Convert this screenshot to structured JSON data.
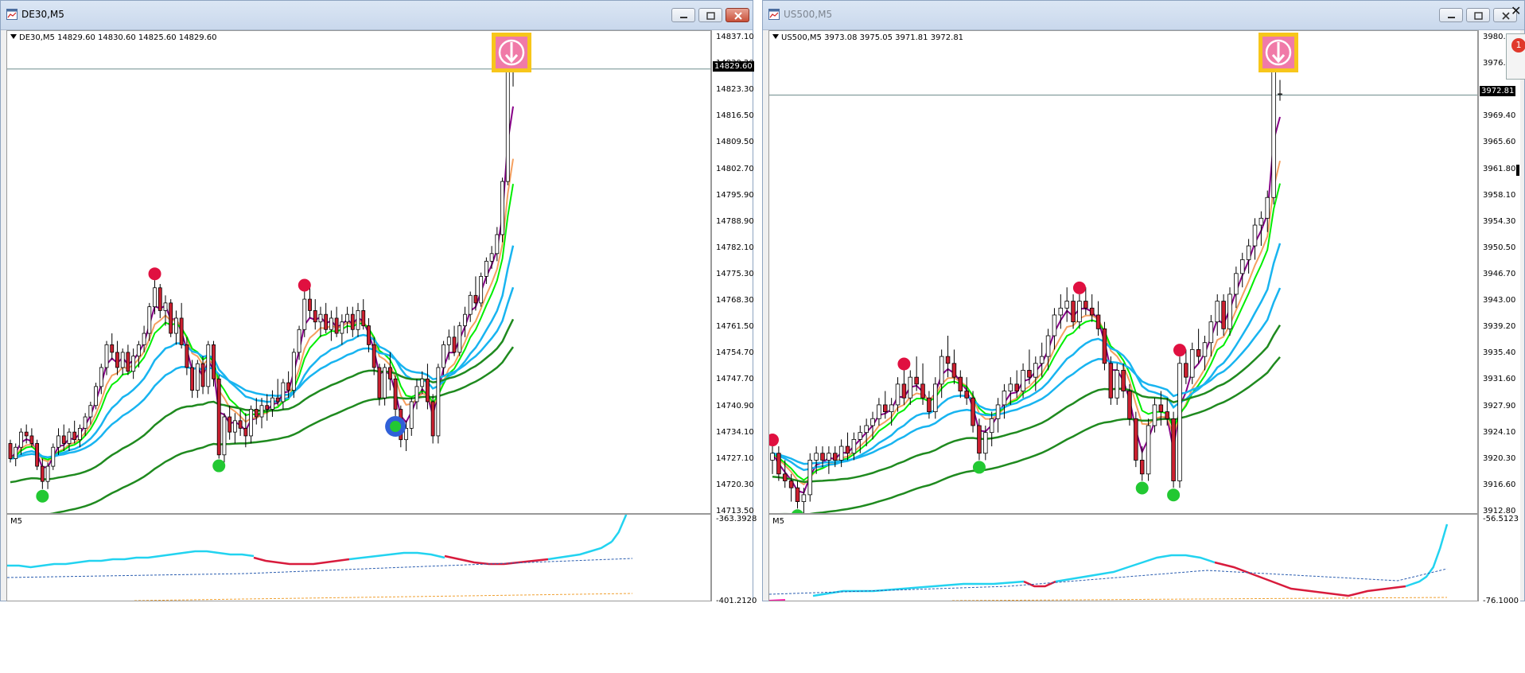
{
  "windows": [
    {
      "id": "de30",
      "title": "DE30,M5",
      "ohlc_label": "DE30,M5  14829.60 14830.60 14825.60 14829.60",
      "indicator_label": "M5",
      "price_ticks": [
        "14837.10",
        "14830.20",
        "14823.30",
        "14816.50",
        "14809.50",
        "14802.70",
        "14795.90",
        "14788.90",
        "14782.10",
        "14775.30",
        "14768.30",
        "14761.50",
        "14754.70",
        "14747.70",
        "14740.90",
        "14734.10",
        "14727.10",
        "14720.30",
        "14713.50"
      ],
      "current_price": "14829.60",
      "indicator_value": "-363.3928",
      "indicator_low_value": "-401.2120",
      "price_range": [
        14713.5,
        14837.1
      ],
      "candles": [
        [
          14731,
          14732,
          14726,
          14727
        ],
        [
          14727,
          14731,
          14725,
          14730
        ],
        [
          14730,
          14735,
          14728,
          14734
        ],
        [
          14734,
          14736,
          14731,
          14733
        ],
        [
          14733,
          14735,
          14730,
          14731
        ],
        [
          14731,
          14732,
          14724,
          14725
        ],
        [
          14725,
          14727,
          14719,
          14721
        ],
        [
          14721,
          14726,
          14719,
          14725
        ],
        [
          14725,
          14731,
          14724,
          14730
        ],
        [
          14730,
          14735,
          14728,
          14733
        ],
        [
          14733,
          14736,
          14729,
          14731
        ],
        [
          14731,
          14735,
          14729,
          14734
        ],
        [
          14734,
          14737,
          14731,
          14732
        ],
        [
          14732,
          14736,
          14730,
          14735
        ],
        [
          14735,
          14739,
          14733,
          14738
        ],
        [
          14738,
          14742,
          14736,
          14741
        ],
        [
          14741,
          14747,
          14740,
          14746
        ],
        [
          14746,
          14752,
          14744,
          14751
        ],
        [
          14751,
          14758,
          14749,
          14757
        ],
        [
          14757,
          14760,
          14753,
          14755
        ],
        [
          14755,
          14758,
          14749,
          14751
        ],
        [
          14751,
          14756,
          14749,
          14755
        ],
        [
          14755,
          14757,
          14749,
          14750
        ],
        [
          14750,
          14756,
          14748,
          14754
        ],
        [
          14754,
          14758,
          14751,
          14757
        ],
        [
          14757,
          14762,
          14755,
          14760
        ],
        [
          14760,
          14768,
          14758,
          14767
        ],
        [
          14767,
          14774,
          14765,
          14772
        ],
        [
          14772,
          14773,
          14764,
          14766
        ],
        [
          14766,
          14770,
          14762,
          14768
        ],
        [
          14768,
          14769,
          14759,
          14760
        ],
        [
          14760,
          14766,
          14757,
          14764
        ],
        [
          14764,
          14768,
          14756,
          14757
        ],
        [
          14757,
          14759,
          14749,
          14751
        ],
        [
          14751,
          14753,
          14743,
          14745
        ],
        [
          14745,
          14753,
          14743,
          14752
        ],
        [
          14752,
          14754,
          14744,
          14746
        ],
        [
          14746,
          14758,
          14744,
          14757
        ],
        [
          14757,
          14758,
          14746,
          14748
        ],
        [
          14748,
          14749,
          14727,
          14728
        ],
        [
          14728,
          14739,
          14726,
          14738
        ],
        [
          14738,
          14741,
          14732,
          14734
        ],
        [
          14734,
          14739,
          14731,
          14737
        ],
        [
          14737,
          14740,
          14733,
          14735
        ],
        [
          14735,
          14739,
          14730,
          14733
        ],
        [
          14733,
          14741,
          14731,
          14740
        ],
        [
          14740,
          14743,
          14736,
          14738
        ],
        [
          14738,
          14743,
          14735,
          14741
        ],
        [
          14741,
          14744,
          14737,
          14740
        ],
        [
          14740,
          14745,
          14738,
          14743
        ],
        [
          14743,
          14748,
          14741,
          14742
        ],
        [
          14742,
          14748,
          14740,
          14747
        ],
        [
          14747,
          14750,
          14743,
          14745
        ],
        [
          14745,
          14756,
          14743,
          14755
        ],
        [
          14755,
          14762,
          14753,
          14761
        ],
        [
          14761,
          14771,
          14759,
          14769
        ],
        [
          14769,
          14772,
          14764,
          14766
        ],
        [
          14766,
          14769,
          14761,
          14763
        ],
        [
          14763,
          14767,
          14759,
          14765
        ],
        [
          14765,
          14768,
          14760,
          14761
        ],
        [
          14761,
          14766,
          14758,
          14764
        ],
        [
          14764,
          14767,
          14759,
          14760
        ],
        [
          14760,
          14765,
          14757,
          14763
        ],
        [
          14763,
          14767,
          14760,
          14765
        ],
        [
          14765,
          14767,
          14759,
          14761
        ],
        [
          14761,
          14768,
          14759,
          14766
        ],
        [
          14766,
          14769,
          14761,
          14762
        ],
        [
          14762,
          14764,
          14755,
          14757
        ],
        [
          14757,
          14759,
          14749,
          14751
        ],
        [
          14751,
          14752,
          14741,
          14743
        ],
        [
          14743,
          14752,
          14741,
          14751
        ],
        [
          14751,
          14755,
          14745,
          14748
        ],
        [
          14748,
          14749,
          14738,
          14740
        ],
        [
          14740,
          14741,
          14730,
          14732
        ],
        [
          14732,
          14737,
          14729,
          14735
        ],
        [
          14735,
          14743,
          14733,
          14742
        ],
        [
          14742,
          14748,
          14740,
          14746
        ],
        [
          14746,
          14750,
          14744,
          14748
        ],
        [
          14748,
          14752,
          14740,
          14742
        ],
        [
          14742,
          14744,
          14731,
          14733
        ],
        [
          14733,
          14752,
          14731,
          14751
        ],
        [
          14751,
          14758,
          14749,
          14757
        ],
        [
          14757,
          14761,
          14753,
          14759
        ],
        [
          14759,
          14762,
          14754,
          14755
        ],
        [
          14755,
          14763,
          14754,
          14762
        ],
        [
          14762,
          14767,
          14759,
          14765
        ],
        [
          14765,
          14771,
          14763,
          14770
        ],
        [
          14770,
          14775,
          14766,
          14768
        ],
        [
          14768,
          14776,
          14767,
          14775
        ],
        [
          14775,
          14780,
          14773,
          14779
        ],
        [
          14779,
          14783,
          14777,
          14781
        ],
        [
          14781,
          14788,
          14779,
          14786
        ],
        [
          14786,
          14801,
          14784,
          14800
        ],
        [
          14800,
          14832,
          14799,
          14830
        ],
        [
          14830,
          14831,
          14825,
          14829
        ]
      ],
      "markers": [
        {
          "index": 6,
          "type": "green-low"
        },
        {
          "index": 27,
          "type": "red-high"
        },
        {
          "index": 39,
          "type": "green-low"
        },
        {
          "index": 55,
          "type": "red-high"
        },
        {
          "index": 72,
          "type": "blue-green-low"
        }
      ],
      "indicator_cyan": [
        -381,
        -381,
        -382,
        -381,
        -380,
        -380,
        -379,
        -378,
        -378,
        -377,
        -377,
        -376,
        -376,
        -375,
        -374,
        -373,
        -372,
        -372,
        -373,
        -374,
        -374,
        -375,
        -375,
        -376,
        -377
      ],
      "indicator_red": [
        -376,
        -378,
        -379,
        -380,
        -380,
        -380,
        -379,
        -378,
        -377
      ],
      "indicator_red_b": [
        -375,
        -377,
        -379,
        -380,
        -380,
        -379,
        -378,
        -377
      ],
      "indicator_final": [
        -376,
        -374,
        -372,
        -369,
        -364,
        -358
      ]
    },
    {
      "id": "us500",
      "title": "US500,M5",
      "ohlc_label": "US500,M5  3973.08 3975.05 3971.81 3972.81",
      "indicator_label": "M5",
      "price_ticks": [
        "3980.70",
        "3976.90",
        "3972.81",
        "3969.40",
        "3965.60",
        "3961.80",
        "3958.10",
        "3954.30",
        "3950.50",
        "3946.70",
        "3943.00",
        "3939.20",
        "3935.40",
        "3931.60",
        "3927.90",
        "3924.10",
        "3920.30",
        "3916.60",
        "3912.80"
      ],
      "current_price": "3972.81",
      "indicator_value": "-56.5123",
      "indicator_low_value": "-76.1000",
      "price_range": [
        3912.8,
        3980.7
      ],
      "candles": [
        [
          3920,
          3922,
          3918,
          3921
        ],
        [
          3921,
          3922,
          3917,
          3918
        ],
        [
          3918,
          3920,
          3916,
          3917
        ],
        [
          3917,
          3918,
          3914,
          3916
        ],
        [
          3916,
          3917,
          3913,
          3914
        ],
        [
          3914,
          3916,
          3912,
          3915
        ],
        [
          3915,
          3921,
          3914,
          3920
        ],
        [
          3920,
          3922,
          3918,
          3921
        ],
        [
          3921,
          3922,
          3919,
          3920
        ],
        [
          3920,
          3922,
          3918,
          3921
        ],
        [
          3921,
          3922,
          3919,
          3920
        ],
        [
          3920,
          3923,
          3919,
          3922
        ],
        [
          3922,
          3924,
          3920,
          3921
        ],
        [
          3921,
          3924,
          3920,
          3923
        ],
        [
          3923,
          3925,
          3921,
          3924
        ],
        [
          3924,
          3926,
          3922,
          3925
        ],
        [
          3925,
          3927,
          3923,
          3926
        ],
        [
          3926,
          3929,
          3925,
          3928
        ],
        [
          3928,
          3930,
          3926,
          3927
        ],
        [
          3927,
          3929,
          3925,
          3928
        ],
        [
          3928,
          3932,
          3927,
          3931
        ],
        [
          3931,
          3933,
          3928,
          3929
        ],
        [
          3929,
          3933,
          3928,
          3932
        ],
        [
          3932,
          3935,
          3930,
          3931
        ],
        [
          3931,
          3934,
          3928,
          3929
        ],
        [
          3929,
          3930,
          3926,
          3927
        ],
        [
          3927,
          3932,
          3926,
          3931
        ],
        [
          3931,
          3936,
          3929,
          3935
        ],
        [
          3935,
          3938,
          3932,
          3934
        ],
        [
          3934,
          3936,
          3931,
          3932
        ],
        [
          3932,
          3933,
          3929,
          3930
        ],
        [
          3930,
          3932,
          3928,
          3929
        ],
        [
          3929,
          3930,
          3924,
          3925
        ],
        [
          3925,
          3926,
          3920,
          3921
        ],
        [
          3921,
          3925,
          3920,
          3924
        ],
        [
          3924,
          3927,
          3922,
          3926
        ],
        [
          3926,
          3929,
          3924,
          3928
        ],
        [
          3928,
          3931,
          3926,
          3930
        ],
        [
          3930,
          3932,
          3928,
          3931
        ],
        [
          3931,
          3933,
          3929,
          3930
        ],
        [
          3930,
          3934,
          3929,
          3933
        ],
        [
          3933,
          3936,
          3931,
          3932
        ],
        [
          3932,
          3935,
          3930,
          3934
        ],
        [
          3934,
          3937,
          3932,
          3935
        ],
        [
          3935,
          3939,
          3933,
          3938
        ],
        [
          3938,
          3942,
          3936,
          3941
        ],
        [
          3941,
          3944,
          3939,
          3942
        ],
        [
          3942,
          3945,
          3940,
          3943
        ],
        [
          3943,
          3944,
          3939,
          3940
        ],
        [
          3940,
          3944,
          3939,
          3943
        ],
        [
          3943,
          3945,
          3941,
          3942
        ],
        [
          3942,
          3944,
          3940,
          3941
        ],
        [
          3941,
          3943,
          3938,
          3939
        ],
        [
          3939,
          3940,
          3933,
          3934
        ],
        [
          3934,
          3935,
          3928,
          3929
        ],
        [
          3929,
          3934,
          3928,
          3933
        ],
        [
          3933,
          3934,
          3929,
          3930
        ],
        [
          3930,
          3931,
          3925,
          3926
        ],
        [
          3926,
          3927,
          3919,
          3920
        ],
        [
          3920,
          3922,
          3917,
          3918
        ],
        [
          3918,
          3926,
          3917,
          3925
        ],
        [
          3925,
          3929,
          3924,
          3928
        ],
        [
          3928,
          3930,
          3925,
          3927
        ],
        [
          3927,
          3929,
          3925,
          3926
        ],
        [
          3926,
          3927,
          3916,
          3917
        ],
        [
          3917,
          3935,
          3916,
          3934
        ],
        [
          3934,
          3936,
          3931,
          3932
        ],
        [
          3932,
          3937,
          3931,
          3936
        ],
        [
          3936,
          3939,
          3934,
          3935
        ],
        [
          3935,
          3938,
          3933,
          3937
        ],
        [
          3937,
          3941,
          3935,
          3940
        ],
        [
          3940,
          3944,
          3938,
          3943
        ],
        [
          3943,
          3944,
          3938,
          3939
        ],
        [
          3939,
          3945,
          3938,
          3944
        ],
        [
          3944,
          3948,
          3942,
          3947
        ],
        [
          3947,
          3950,
          3945,
          3949
        ],
        [
          3949,
          3952,
          3947,
          3951
        ],
        [
          3951,
          3955,
          3949,
          3954
        ],
        [
          3954,
          3956,
          3951,
          3955
        ],
        [
          3955,
          3959,
          3953,
          3958
        ],
        [
          3958,
          3978,
          3957,
          3977
        ],
        [
          3973,
          3975,
          3972,
          3973
        ]
      ],
      "markers": [
        {
          "index": 0,
          "type": "red-high"
        },
        {
          "index": 4,
          "type": "green-low"
        },
        {
          "index": 21,
          "type": "red-high"
        },
        {
          "index": 33,
          "type": "green-low"
        },
        {
          "index": 49,
          "type": "red-high"
        },
        {
          "index": 59,
          "type": "green-low"
        },
        {
          "index": 64,
          "type": "green-low"
        },
        {
          "index": 65,
          "type": "red-high"
        }
      ],
      "indicator_cyan": [
        -76,
        -76,
        -76,
        -75,
        -75,
        -74,
        -74,
        -74,
        -73,
        -73,
        -72,
        -72,
        -71,
        -71,
        -71,
        -72
      ],
      "indicator_red": [
        -72,
        -73,
        -73,
        -72
      ],
      "indicator_red_b": [
        -67,
        -68,
        -70,
        -72,
        -73,
        -73,
        -74,
        -74,
        -73,
        -72,
        -72
      ],
      "indicator_cyan_b": [
        -72,
        -71,
        -70,
        -69,
        -68,
        -67,
        -66,
        -66,
        -66,
        -66,
        -66,
        -66,
        -67
      ],
      "indicator_final": [
        -72,
        -71,
        -70,
        -69,
        -65,
        -58
      ]
    }
  ],
  "notification_count": "1",
  "colors": {
    "bull": "#ffffff",
    "bear": "#cc2030",
    "ma_green": "#00ee00",
    "ma_purple": "#880088",
    "ma_orange": "#f5a060",
    "ma_cyan": "#18b4f0",
    "ma_darkgreen": "#1f8a1f",
    "ind_cyan": "#22d3f0",
    "ind_red": "#d81b3c",
    "marker_red": "#e01040",
    "marker_green": "#22c832",
    "marker_blue": "#3060d8"
  },
  "icons": [
    "chart-window-icon",
    "minimize-icon",
    "maximize-icon",
    "close-icon",
    "sell-arrow-icon"
  ]
}
